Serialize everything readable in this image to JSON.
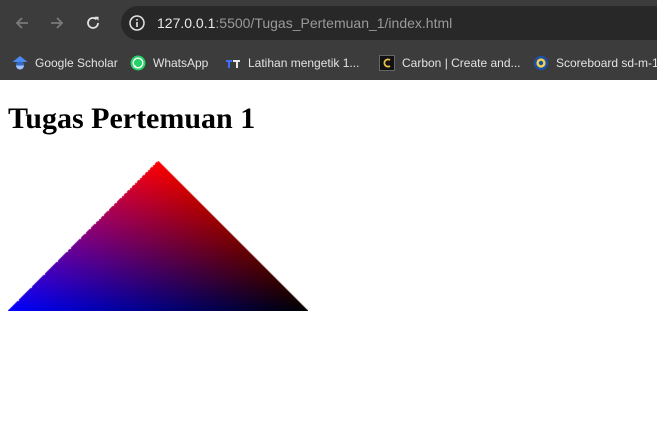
{
  "browser": {
    "url_host": "127.0.0.1",
    "url_path": ":5500/Tugas_Pertemuan_1/index.html",
    "bookmarks": [
      {
        "label": "Google Scholar",
        "icon": "google-scholar-icon"
      },
      {
        "label": "WhatsApp",
        "icon": "whatsapp-icon"
      },
      {
        "label": "Latihan mengetik 1...",
        "icon": "typing-practice-icon"
      },
      {
        "label": "Carbon | Create and...",
        "icon": "carbon-icon"
      },
      {
        "label": "Scoreboard sd-m-1",
        "icon": "scoreboard-icon"
      }
    ]
  },
  "page": {
    "title": "Tugas Pertemuan 1",
    "triangle_vertex_colors": {
      "top": "#ff0000",
      "bottom_left": "#0000ff",
      "bottom_right": "#000000"
    }
  }
}
